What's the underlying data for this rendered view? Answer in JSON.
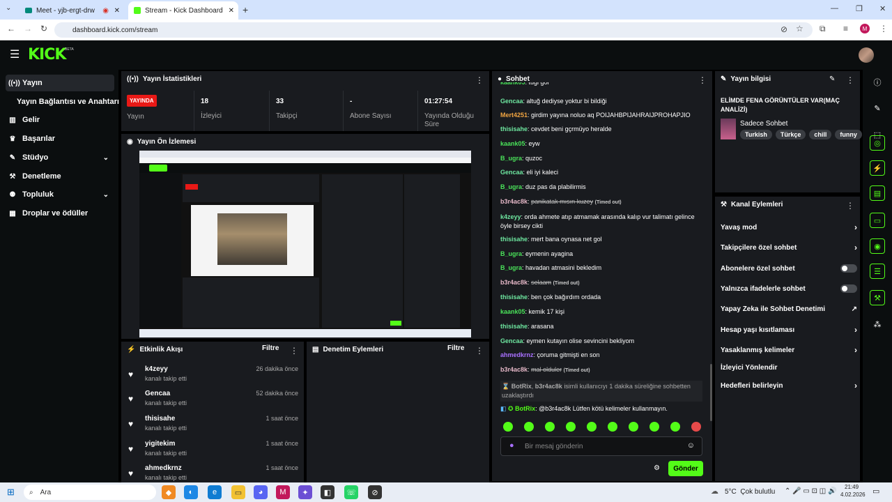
{
  "browser": {
    "tabs": [
      {
        "title": "Meet - yjb-ergt-drw"
      },
      {
        "title": "Stream - Kick Dashboard"
      }
    ],
    "url": "dashboard.kick.com/stream",
    "new_tab_glyph": "+",
    "profile_initial": "M"
  },
  "header": {
    "logo": "KICK",
    "beta": "BETA"
  },
  "sidebar": {
    "items": [
      {
        "label": "Yayın",
        "icon": "broadcast-icon"
      },
      {
        "label": "Yayın Bağlantısı ve Anahtarı",
        "icon": ""
      },
      {
        "label": "Gelir",
        "icon": "chart-icon"
      },
      {
        "label": "Başarılar",
        "icon": "trophy-icon"
      },
      {
        "label": "Stüdyo",
        "icon": "palette-icon"
      },
      {
        "label": "Denetleme",
        "icon": "wrench-icon"
      },
      {
        "label": "Topluluk",
        "icon": "users-icon"
      },
      {
        "label": "Droplar ve ödüller",
        "icon": "gift-icon"
      }
    ]
  },
  "stats": {
    "title": "Yayın İstatistikleri",
    "live_badge": "YAYINDA",
    "live_label": "Yayın",
    "items": [
      {
        "value": "18",
        "label": "İzleyici"
      },
      {
        "value": "33",
        "label": "Takipçi"
      },
      {
        "value": "-",
        "label": "Abone Sayısı"
      },
      {
        "value": "01:27:54",
        "label": "Yayında Olduğu Süre"
      }
    ]
  },
  "preview": {
    "title": "Yayın Ön İzlemesi"
  },
  "activity": {
    "title": "Etkinlik Akışı",
    "filter": "Filtre",
    "items": [
      {
        "name": "k4zeyy",
        "action": "kanalı takip etti",
        "time": "26 dakika önce"
      },
      {
        "name": "Gencaa",
        "action": "kanalı takip etti",
        "time": "52 dakika önce"
      },
      {
        "name": "thisisahe",
        "action": "kanalı takip etti",
        "time": "1 saat önce"
      },
      {
        "name": "yigitekim",
        "action": "kanalı takip etti",
        "time": "1 saat önce"
      },
      {
        "name": "ahmedkrnz",
        "action": "kanalı takip etti",
        "time": "1 saat önce"
      }
    ]
  },
  "moderation": {
    "title": "Denetim Eylemleri",
    "filter": "Filtre"
  },
  "chat": {
    "title": "Sohbet",
    "messages": [
      {
        "user": "kaank05",
        "color": "#4ae35a",
        "text": "tugi gol",
        "deleted": false,
        "timed": false
      },
      {
        "user": "Gencaa",
        "color": "#6ee7a0",
        "text": "altuğ dediyse yoktur bi bildiği",
        "deleted": false,
        "timed": false
      },
      {
        "user": "Mert4251",
        "color": "#f0a441",
        "text": "girdim yayına noluo aq POIJAHBPIJAHRAIJPROHAPJIO",
        "deleted": false,
        "timed": false
      },
      {
        "user": "thisisahe",
        "color": "#6ee7a0",
        "text": "cevdet beni gçrmüyo heralde",
        "deleted": false,
        "timed": false
      },
      {
        "user": "kaank05",
        "color": "#4ae35a",
        "text": "eyw",
        "deleted": false,
        "timed": false
      },
      {
        "user": "B_ugra",
        "color": "#4ae35a",
        "text": "quzoc",
        "deleted": false,
        "timed": false
      },
      {
        "user": "Gencaa",
        "color": "#6ee7a0",
        "text": "eli iyi kaleci",
        "deleted": false,
        "timed": false
      },
      {
        "user": "B_ugra",
        "color": "#4ae35a",
        "text": "duz pas da plabilirmis",
        "deleted": false,
        "timed": false
      },
      {
        "user": "b3r4ac8k",
        "color": "#e6b8c8",
        "text": "panikatak mısın kuzey",
        "deleted": true,
        "timed": true
      },
      {
        "user": "k4zeyy",
        "color": "#6ee7a0",
        "text": "orda ahmete atıp atmamak arasında kalıp vur talimatı gelince öyle birsey cikti",
        "deleted": false,
        "timed": false
      },
      {
        "user": "thisisahe",
        "color": "#6ee7a0",
        "text": "mert bana oynasa net gol",
        "deleted": false,
        "timed": false
      },
      {
        "user": "B_ugra",
        "color": "#4ae35a",
        "text": "eymenin ayagina",
        "deleted": false,
        "timed": false
      },
      {
        "user": "B_ugra",
        "color": "#4ae35a",
        "text": "havadan atmasini bekledim",
        "deleted": false,
        "timed": false
      },
      {
        "user": "b3r4ac8k",
        "color": "#e6b8c8",
        "text": "selaam",
        "deleted": true,
        "timed": true
      },
      {
        "user": "thisisahe",
        "color": "#6ee7a0",
        "text": "ben çok bağırdım ordada",
        "deleted": false,
        "timed": false
      },
      {
        "user": "kaank05",
        "color": "#4ae35a",
        "text": "kemik 17 kişi",
        "deleted": false,
        "timed": false
      },
      {
        "user": "thisisahe",
        "color": "#6ee7a0",
        "text": "arasana",
        "deleted": false,
        "timed": false
      },
      {
        "user": "Gencaa",
        "color": "#6ee7a0",
        "text": "eymen kutayın olise sevincini bekliyom",
        "deleted": false,
        "timed": false
      },
      {
        "user": "ahmedkrnz",
        "color": "#a970ff",
        "text": "çoruma gitmişti en son",
        "deleted": false,
        "timed": false
      },
      {
        "user": "b3r4ac8k",
        "color": "#e6b8c8",
        "text": "mal olduler",
        "deleted": true,
        "timed": true
      }
    ],
    "timed_out_label": "(Timed out)",
    "system": {
      "user": "BotRix",
      "target": "b3r4ac8k",
      "text": "isimli kullanıcıyı 1 dakika süreliğine sohbetten uzaklaştırdı"
    },
    "bot": {
      "user": "BotRix",
      "text": "@b3r4ac8k Lütfen kötü kelimeler kullanmayın."
    },
    "input_placeholder": "Bir mesaj gönderin",
    "send": "Gönder"
  },
  "stream_info": {
    "title_label": "Yayın bilgisi",
    "stream_title": "ELİMDE FENA GÖRÜNTÜLER VAR(MAÇ ANALİZİ)",
    "category": "Sadece Sohbet",
    "tags": [
      "Turkish",
      "Türkçe",
      "chill",
      "funny"
    ]
  },
  "channel_actions": {
    "title": "Kanal Eylemleri",
    "items": [
      {
        "label": "Yavaş mod",
        "control": "arrow"
      },
      {
        "label": "Takipçilere özel sohbet",
        "control": "arrow"
      },
      {
        "label": "Abonelere özel sohbet",
        "control": "toggle"
      },
      {
        "label": "Yalnızca ifadelerle sohbet",
        "control": "toggle"
      },
      {
        "label": "Yapay Zeka ile Sohbet Denetimi",
        "control": "external"
      },
      {
        "label": "Hesap yaşı kısıtlaması",
        "control": "arrow"
      },
      {
        "label": "Yasaklanmış kelimeler",
        "control": "arrow"
      },
      {
        "label": "İzleyici Yönlendir",
        "control": "none"
      },
      {
        "label": "Hedefleri belirleyin",
        "control": "arrow"
      }
    ]
  },
  "taskbar": {
    "search": "Ara",
    "weather": "5°C  Çok bulutlu",
    "time": "21:49",
    "date": "4.02.2026"
  }
}
